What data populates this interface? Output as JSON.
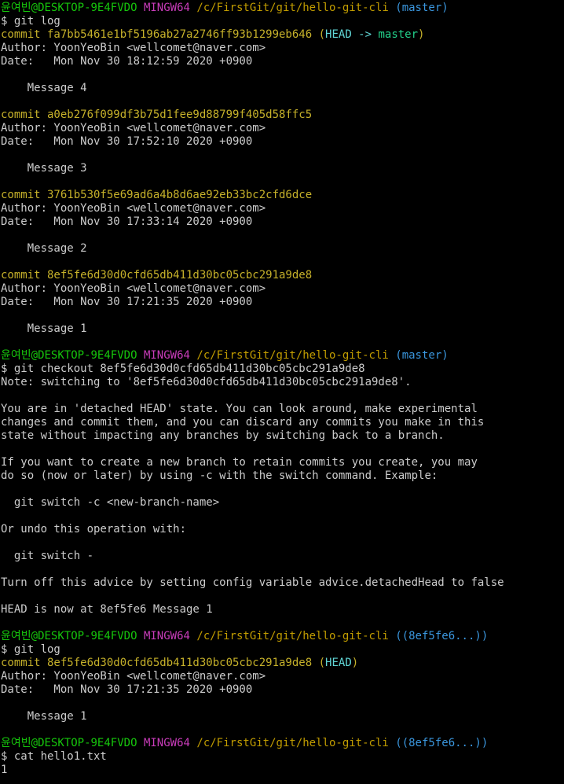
{
  "prompt": {
    "user": "윤여빈",
    "host": "@DESKTOP-9E4FVDO",
    "shell": "MINGW64",
    "path": "/c/FirstGit/git/hello-git-cli",
    "branch_master": "(master)",
    "branch_detached": "((8ef5fe6...))"
  },
  "colors": {
    "user_host": "#16c60c",
    "shell": "#c83cb9",
    "path": "#c19c00",
    "branch": "#3a96dd",
    "commit_hash": "#c6b12a",
    "text": "#cccccc",
    "background": "#000000"
  },
  "block1": {
    "command": "$ git log",
    "commits": [
      {
        "hash_line": "commit fa7bb5461e1bf5196ab27a2746ff93b1299eb646",
        "decoration_open": "(",
        "decoration_head": "HEAD -> ",
        "decoration_ref": "master",
        "decoration_close": ")",
        "author": "Author: YoonYeoBin <wellcomet@naver.com>",
        "date": "Date:   Mon Nov 30 18:12:59 2020 +0900",
        "message": "    Message 4"
      },
      {
        "hash_line": "commit a0eb276f099df3b75d1fee9d88799f405d58ffc5",
        "author": "Author: YoonYeoBin <wellcomet@naver.com>",
        "date": "Date:   Mon Nov 30 17:52:10 2020 +0900",
        "message": "    Message 3"
      },
      {
        "hash_line": "commit 3761b530f5e69ad6a4b8d6ae92eb33bc2cfd6dce",
        "author": "Author: YoonYeoBin <wellcomet@naver.com>",
        "date": "Date:   Mon Nov 30 17:33:14 2020 +0900",
        "message": "    Message 2"
      },
      {
        "hash_line": "commit 8ef5fe6d30d0cfd65db411d30bc05cbc291a9de8",
        "author": "Author: YoonYeoBin <wellcomet@naver.com>",
        "date": "Date:   Mon Nov 30 17:21:35 2020 +0900",
        "message": "    Message 1"
      }
    ]
  },
  "block2": {
    "command": "$ git checkout 8ef5fe6d30d0cfd65db411d30bc05cbc291a9de8",
    "output": [
      "Note: switching to '8ef5fe6d30d0cfd65db411d30bc05cbc291a9de8'.",
      "",
      "You are in 'detached HEAD' state. You can look around, make experimental",
      "changes and commit them, and you can discard any commits you make in this",
      "state without impacting any branches by switching back to a branch.",
      "",
      "If you want to create a new branch to retain commits you create, you may",
      "do so (now or later) by using -c with the switch command. Example:",
      "",
      "  git switch -c <new-branch-name>",
      "",
      "Or undo this operation with:",
      "",
      "  git switch -",
      "",
      "Turn off this advice by setting config variable advice.detachedHead to false",
      "",
      "HEAD is now at 8ef5fe6 Message 1"
    ]
  },
  "block3": {
    "command": "$ git log",
    "hash_line": "commit 8ef5fe6d30d0cfd65db411d30bc05cbc291a9de8",
    "decoration_open": "(",
    "decoration_head": "HEAD",
    "decoration_close": ")",
    "author": "Author: YoonYeoBin <wellcomet@naver.com>",
    "date": "Date:   Mon Nov 30 17:21:35 2020 +0900",
    "message": "    Message 1"
  },
  "block4": {
    "command": "$ cat hello1.txt",
    "output": "1"
  }
}
